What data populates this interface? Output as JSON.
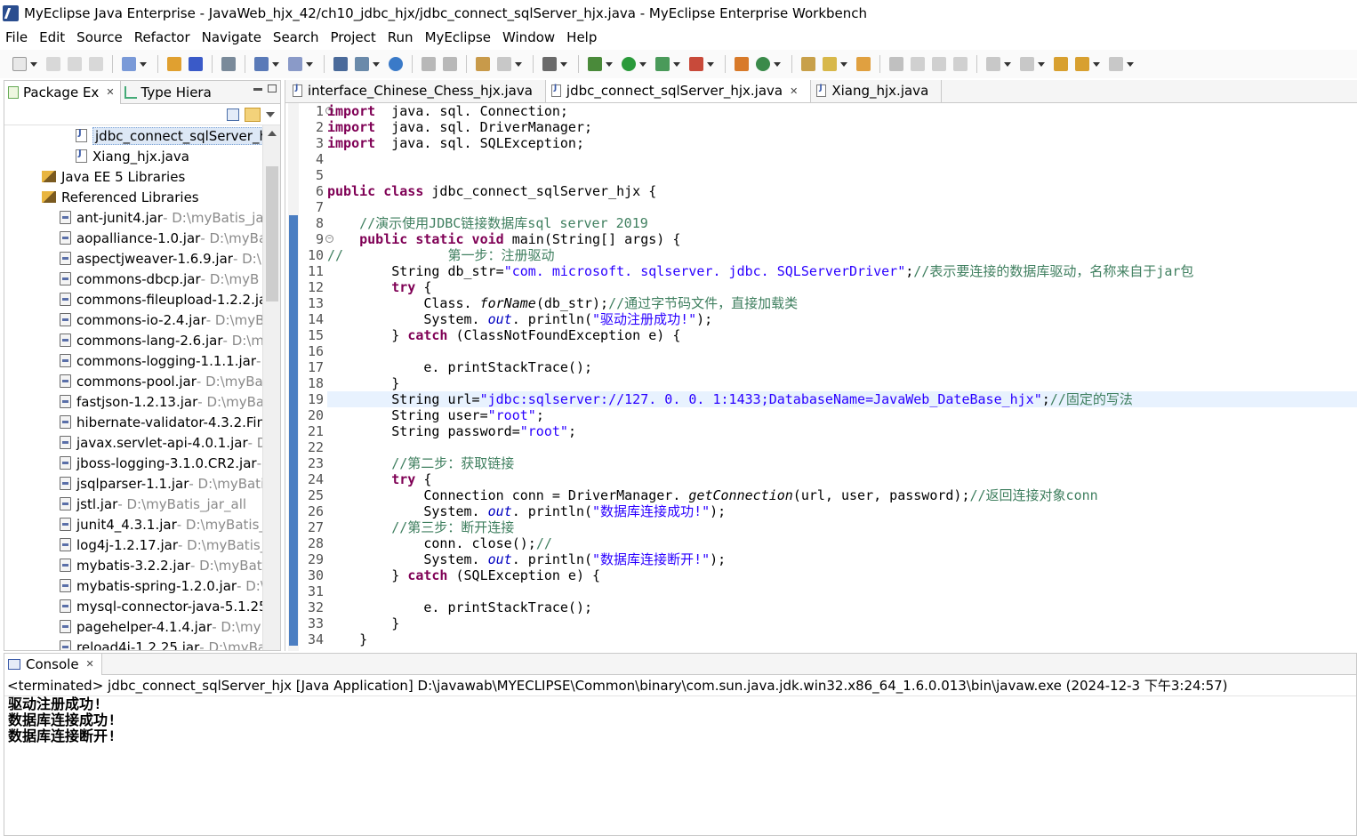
{
  "window": {
    "title": "MyEclipse Java Enterprise - JavaWeb_hjx_42/ch10_jdbc_hjx/jdbc_connect_sqlServer_hjx.java - MyEclipse Enterprise Workbench"
  },
  "menu": [
    "File",
    "Edit",
    "Source",
    "Refactor",
    "Navigate",
    "Search",
    "Project",
    "Run",
    "MyEclipse",
    "Window",
    "Help"
  ],
  "left_panel": {
    "tabs": [
      {
        "label": "Package Ex",
        "icon": "package-explorer-icon",
        "closable": true
      },
      {
        "label": "Type Hiera",
        "icon": "type-hierarchy-icon",
        "closable": false
      }
    ],
    "tree": [
      {
        "label": "jdbc_connect_sqlServer_h",
        "path": "",
        "icon": "java-file",
        "indent": 80,
        "selected": true
      },
      {
        "label": "Xiang_hjx.java",
        "path": "",
        "icon": "java-file",
        "indent": 80
      },
      {
        "label": "Java EE 5 Libraries",
        "path": "",
        "icon": "library",
        "indent": 42
      },
      {
        "label": "Referenced Libraries",
        "path": "",
        "icon": "library",
        "indent": 42
      },
      {
        "label": "ant-junit4.jar",
        "path": " - D:\\myBatis_jar",
        "icon": "jar",
        "indent": 62
      },
      {
        "label": "aopalliance-1.0.jar",
        "path": " - D:\\myBa",
        "icon": "jar",
        "indent": 62
      },
      {
        "label": "aspectjweaver-1.6.9.jar",
        "path": " - D:\\r",
        "icon": "jar",
        "indent": 62
      },
      {
        "label": "commons-dbcp.jar",
        "path": " - D:\\myB",
        "icon": "jar",
        "indent": 62
      },
      {
        "label": "commons-fileupload-1.2.2.ja",
        "path": "",
        "icon": "jar",
        "indent": 62
      },
      {
        "label": "commons-io-2.4.jar",
        "path": " - D:\\myB",
        "icon": "jar",
        "indent": 62
      },
      {
        "label": "commons-lang-2.6.jar",
        "path": " - D:\\m",
        "icon": "jar",
        "indent": 62
      },
      {
        "label": "commons-logging-1.1.1.jar",
        "path": " -",
        "icon": "jar",
        "indent": 62
      },
      {
        "label": "commons-pool.jar",
        "path": " - D:\\myBa",
        "icon": "jar",
        "indent": 62
      },
      {
        "label": "fastjson-1.2.13.jar",
        "path": " - D:\\myBat",
        "icon": "jar",
        "indent": 62
      },
      {
        "label": "hibernate-validator-4.3.2.Fin",
        "path": "",
        "icon": "jar",
        "indent": 62
      },
      {
        "label": "javax.servlet-api-4.0.1.jar",
        "path": " - D",
        "icon": "jar",
        "indent": 62
      },
      {
        "label": "jboss-logging-3.1.0.CR2.jar",
        "path": " -",
        "icon": "jar",
        "indent": 62
      },
      {
        "label": "jsqlparser-1.1.jar",
        "path": " - D:\\myBati",
        "icon": "jar",
        "indent": 62
      },
      {
        "label": "jstl.jar",
        "path": " - D:\\myBatis_jar_all",
        "icon": "jar",
        "indent": 62
      },
      {
        "label": "junit4_4.3.1.jar",
        "path": " - D:\\myBatis_j",
        "icon": "jar",
        "indent": 62
      },
      {
        "label": "log4j-1.2.17.jar",
        "path": " - D:\\myBatis_",
        "icon": "jar",
        "indent": 62
      },
      {
        "label": "mybatis-3.2.2.jar",
        "path": " - D:\\myBati:",
        "icon": "jar",
        "indent": 62
      },
      {
        "label": "mybatis-spring-1.2.0.jar",
        "path": " - D:\\",
        "icon": "jar",
        "indent": 62
      },
      {
        "label": "mysql-connector-java-5.1.25",
        "path": "",
        "icon": "jar",
        "indent": 62
      },
      {
        "label": "pagehelper-4.1.4.jar",
        "path": " - D:\\my",
        "icon": "jar",
        "indent": 62
      },
      {
        "label": "reload4j-1.2.25.jar",
        "path": " - D:\\myBa",
        "icon": "jar",
        "indent": 62
      }
    ]
  },
  "editor": {
    "tabs": [
      {
        "label": "interface_Chinese_Chess_hjx.java",
        "active": false,
        "closable": false
      },
      {
        "label": "jdbc_connect_sqlServer_hjx.java",
        "active": true,
        "closable": true
      },
      {
        "label": "Xiang_hjx.java",
        "active": false,
        "closable": false
      }
    ],
    "current_line": 19,
    "lines": [
      {
        "n": "1",
        "fold": true,
        "segs": [
          [
            "kw",
            "import"
          ],
          [
            "",
            "  java. sql. Connection;"
          ]
        ]
      },
      {
        "n": "2",
        "segs": [
          [
            "kw",
            "import"
          ],
          [
            "",
            "  java. sql. DriverManager;"
          ]
        ]
      },
      {
        "n": "3",
        "segs": [
          [
            "kw",
            "import"
          ],
          [
            "",
            "  java. sql. SQLException;"
          ]
        ]
      },
      {
        "n": "4",
        "segs": []
      },
      {
        "n": "5",
        "segs": []
      },
      {
        "n": "6",
        "segs": [
          [
            "kw",
            "public class"
          ],
          [
            "",
            " jdbc_connect_sqlServer_hjx {"
          ]
        ]
      },
      {
        "n": "7",
        "segs": []
      },
      {
        "n": "8",
        "segs": [
          [
            "",
            "    "
          ],
          [
            "cm",
            "//演示使用JDBC链接数据库sql server 2019"
          ]
        ]
      },
      {
        "n": "9",
        "fold": true,
        "segs": [
          [
            "",
            "    "
          ],
          [
            "kw",
            "public static void"
          ],
          [
            "",
            " main(String[] args) {"
          ]
        ]
      },
      {
        "n": "10",
        "segs": [
          [
            "cm",
            "//             第一步：注册驱动"
          ]
        ]
      },
      {
        "n": "11",
        "segs": [
          [
            "",
            "        String db_str="
          ],
          [
            "str",
            "\"com. microsoft. sqlserver. jdbc. SQLServerDriver\""
          ],
          [
            "",
            ";"
          ],
          [
            "cm",
            "//表示要连接的数据库驱动，名称来自于jar包"
          ]
        ]
      },
      {
        "n": "12",
        "segs": [
          [
            "",
            "        "
          ],
          [
            "kw",
            "try"
          ],
          [
            "",
            " {"
          ]
        ]
      },
      {
        "n": "13",
        "segs": [
          [
            "",
            "            Class. "
          ],
          [
            "sm",
            "forName"
          ],
          [
            "",
            "(db_str);"
          ],
          [
            "cm",
            "//通过字节码文件，直接加载类"
          ]
        ]
      },
      {
        "n": "14",
        "segs": [
          [
            "",
            "            System. "
          ],
          [
            "it",
            "out"
          ],
          [
            "",
            ". println("
          ],
          [
            "str",
            "\"驱动注册成功!\""
          ],
          [
            "",
            ");"
          ]
        ]
      },
      {
        "n": "15",
        "segs": [
          [
            "",
            "        } "
          ],
          [
            "kw",
            "catch"
          ],
          [
            "",
            " (ClassNotFoundException e) {"
          ]
        ]
      },
      {
        "n": "16",
        "segs": []
      },
      {
        "n": "17",
        "segs": [
          [
            "",
            "            e. printStackTrace();"
          ]
        ]
      },
      {
        "n": "18",
        "segs": [
          [
            "",
            "        }"
          ]
        ]
      },
      {
        "n": "19",
        "segs": [
          [
            "",
            "        String url="
          ],
          [
            "str",
            "\"jdbc:sqlserver://127. 0. 0. 1:1433;DatabaseName=JavaWeb_DateBase_hjx\""
          ],
          [
            "",
            ";"
          ],
          [
            "cm",
            "//固定的写法"
          ]
        ]
      },
      {
        "n": "20",
        "segs": [
          [
            "",
            "        String user="
          ],
          [
            "str",
            "\"root\""
          ],
          [
            "",
            ";"
          ]
        ]
      },
      {
        "n": "21",
        "segs": [
          [
            "",
            "        String password="
          ],
          [
            "str",
            "\"root\""
          ],
          [
            "",
            ";"
          ]
        ]
      },
      {
        "n": "22",
        "segs": []
      },
      {
        "n": "23",
        "segs": [
          [
            "",
            "        "
          ],
          [
            "cm",
            "//第二步：获取链接"
          ]
        ]
      },
      {
        "n": "24",
        "segs": [
          [
            "",
            "        "
          ],
          [
            "kw",
            "try"
          ],
          [
            "",
            " {"
          ]
        ]
      },
      {
        "n": "25",
        "segs": [
          [
            "",
            "            Connection conn = DriverManager. "
          ],
          [
            "sm",
            "getConnection"
          ],
          [
            "",
            "(url, user, password);"
          ],
          [
            "cm",
            "//返回连接对象conn"
          ]
        ]
      },
      {
        "n": "26",
        "segs": [
          [
            "",
            "            System. "
          ],
          [
            "it",
            "out"
          ],
          [
            "",
            ". println("
          ],
          [
            "str",
            "\"数据库连接成功!\""
          ],
          [
            "",
            ");"
          ]
        ]
      },
      {
        "n": "27",
        "segs": [
          [
            "",
            "        "
          ],
          [
            "cm",
            "//第三步：断开连接"
          ]
        ]
      },
      {
        "n": "28",
        "segs": [
          [
            "",
            "            conn. close();"
          ],
          [
            "cm",
            "//"
          ]
        ]
      },
      {
        "n": "29",
        "segs": [
          [
            "",
            "            System. "
          ],
          [
            "it",
            "out"
          ],
          [
            "",
            ". println("
          ],
          [
            "str",
            "\"数据库连接断开!\""
          ],
          [
            "",
            ");"
          ]
        ]
      },
      {
        "n": "30",
        "segs": [
          [
            "",
            "        } "
          ],
          [
            "kw",
            "catch"
          ],
          [
            "",
            " (SQLException e) {"
          ]
        ]
      },
      {
        "n": "31",
        "segs": []
      },
      {
        "n": "32",
        "segs": [
          [
            "",
            "            e. printStackTrace();"
          ]
        ]
      },
      {
        "n": "33",
        "segs": [
          [
            "",
            "        }"
          ]
        ]
      },
      {
        "n": "34",
        "segs": [
          [
            "",
            "    }"
          ]
        ]
      }
    ]
  },
  "console": {
    "tab_label": "Console",
    "status": "<terminated> jdbc_connect_sqlServer_hjx [Java Application] D:\\javawab\\MYECLIPSE\\Common\\binary\\com.sun.java.jdk.win32.x86_64_1.6.0.013\\bin\\javaw.exe (2024-12-3 下午3:24:57)",
    "output": [
      "驱动注册成功!",
      "数据库连接成功!",
      "数据库连接断开!"
    ]
  },
  "colors": {
    "keyword": "#7f0055",
    "string": "#2a00ff",
    "comment": "#3f7f5f",
    "field": "#0000c0",
    "current_line": "#e8f2fe"
  }
}
